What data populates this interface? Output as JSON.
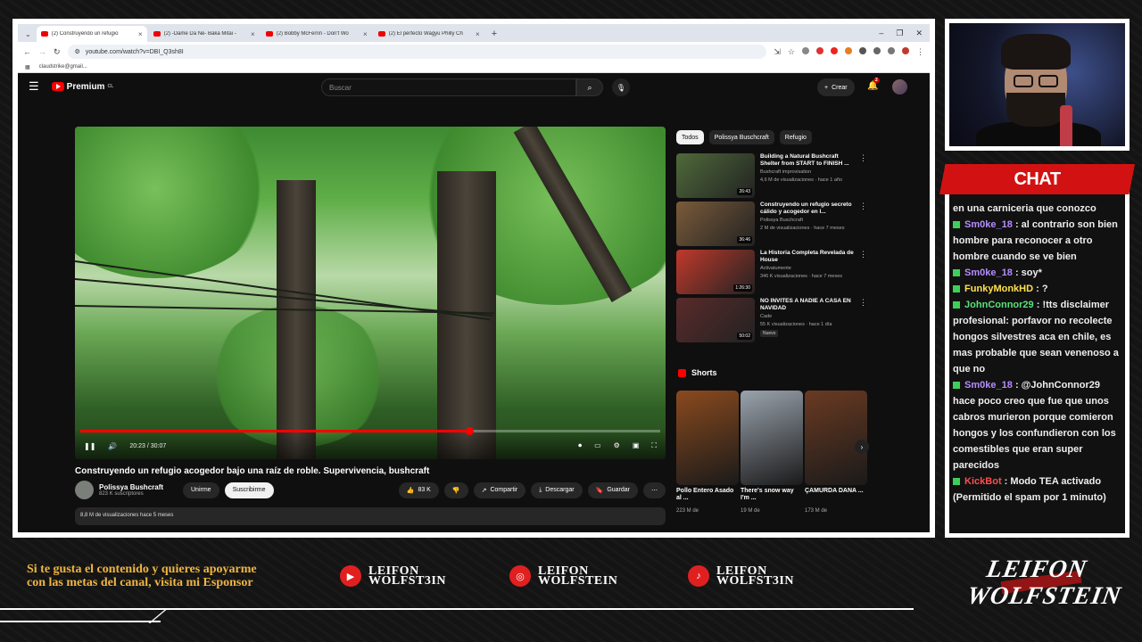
{
  "browser": {
    "tabs": [
      {
        "label": "(2) Construyendo un refugio"
      },
      {
        "label": "(2) -Dame Da Ne- Baka Mitai -"
      },
      {
        "label": "(2) Bobby McFerrin - Don't Wo"
      },
      {
        "label": "(2) El perfecto Wagyu Philly Ch"
      }
    ],
    "new_tab": "+",
    "url": "youtube.com/watch?v=DBI_Q3sh8I",
    "bookmark": "claudstrike@gmail..."
  },
  "youtube": {
    "logo": "Premium",
    "logo_sup": "CL",
    "search_placeholder": "Buscar",
    "create": "Crear",
    "notif_count": "2",
    "player": {
      "time": "20:23 / 30:07",
      "progress": 0.67
    },
    "video_title": "Construyendo un refugio acogedor bajo una raíz de roble. Supervivencia, bushcraft",
    "channel": {
      "name": "Polissya Bushcraft",
      "subs": "823 K suscriptores"
    },
    "join": "Unirme",
    "subscribe": "Suscribirme",
    "likes": "83 K",
    "share": "Compartir",
    "download": "Descargar",
    "save": "Guardar",
    "views_line": "8,8 M de visualizaciones  hace 5 meses",
    "chips": [
      "Todos",
      "Polissya Buschcraft",
      "Refugio"
    ],
    "recs": [
      {
        "title": "Building a Natural Bushcraft Shelter from START to FINISH ...",
        "channel": "Bushcraft improvisation",
        "meta": "4,6 M de visualizaciones · hace 1 año",
        "duration": "26:43",
        "color": "#4f6a3a"
      },
      {
        "title": "Construyendo un refugio secreto cálido y acogedor en l...",
        "channel": "Polissya Buschcraft",
        "meta": "2 M de visualizaciones · hace 7 meses",
        "duration": "36:46",
        "color": "#7a5b3a"
      },
      {
        "title": "La Historia Completa Revelada de House",
        "channel": "Activatumente",
        "meta": "346 K visualizaciones · hace 7 meses",
        "duration": "1:26:30",
        "color": "#c0392b"
      },
      {
        "title": "NO INVITES A NADIE A CASA EN NAVIDAD",
        "channel": "Cade",
        "meta": "55 K visualizaciones · hace 1 día",
        "duration": "50:02",
        "badge": "Nuevo",
        "color": "#5a2a2a"
      }
    ],
    "shorts_label": "Shorts",
    "shorts": [
      {
        "title": "Pollo Entero Asado al ...",
        "views": "223 M de",
        "color": "#8a4a1e"
      },
      {
        "title": "There's snow way I'm ...",
        "views": "19 M de",
        "color": "#9aa3ad"
      },
      {
        "title": "ÇAMURDA DANA ...",
        "views": "173 M de",
        "color": "#6a3a22"
      }
    ]
  },
  "chat": {
    "title": "CHAT",
    "messages": [
      {
        "user": "",
        "text": "en una carniceria que conozco",
        "color": "#eee"
      },
      {
        "user": "Sm0ke_18",
        "text": ": al contrario son bien hombre para reconocer a otro hombre cuando se ve bien",
        "color": "#b48cff"
      },
      {
        "user": "Sm0ke_18",
        "text": ": soy*",
        "color": "#b48cff"
      },
      {
        "user": "FunkyMonkHD",
        "text": ": ?",
        "color": "#ffe14d"
      },
      {
        "user": "JohnConnor29",
        "text": ": !tts disclaimer profesional: porfavor no recolecte hongos silvestres aca en chile, es mas probable que sean venenoso a que no",
        "color": "#5ce07a"
      },
      {
        "user": "Sm0ke_18",
        "text": ": @JohnConnor29 hace poco creo que fue que unos cabros murieron porque comieron hongos y los confundieron con los comestibles que eran super parecidos",
        "color": "#b48cff"
      },
      {
        "user": "KickBot",
        "text": ": Modo TEA activado (Permitido el spam por 1 minuto)",
        "color": "#ff4d4d"
      }
    ]
  },
  "footer": {
    "sponsor": "Si te gusta el contenido y quieres apoyarme con las metas del canal, visita mi Esponsor",
    "socials": [
      {
        "icon": "youtube-icon",
        "line1": "LEIFON",
        "line2": "WOLFST3IN"
      },
      {
        "icon": "instagram-icon",
        "line1": "LEIFON",
        "line2": "WOLFSTEIN"
      },
      {
        "icon": "tiktok-icon",
        "line1": "LEIFON",
        "line2": "WOLFST3IN"
      }
    ],
    "brand1": "LEIFON",
    "brand2": "WOLFSTEIN"
  }
}
